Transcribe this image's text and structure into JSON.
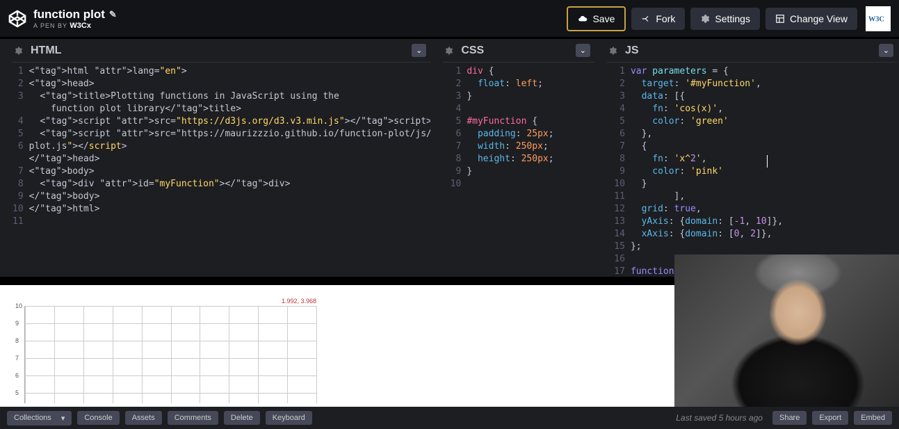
{
  "header": {
    "title": "function plot",
    "byline_prefix": "A PEN BY",
    "byline_author": "W3Cx"
  },
  "actions": {
    "save": "Save",
    "fork": "Fork",
    "settings": "Settings",
    "change_view": "Change View"
  },
  "panels": {
    "html": {
      "title": "HTML"
    },
    "css": {
      "title": "CSS"
    },
    "js": {
      "title": "JS"
    }
  },
  "code_html": [
    "<html lang=\"en\">",
    "<head>",
    "  <title>Plotting functions in JavaScript using the",
    "    function plot library</title>",
    "  <script src=\"https://d3js.org/d3.v3.min.js\"></script>",
    "  <script src=\"https://maurizzzio.github.io/function-plot/js/function-",
    "plot.js\"></script>",
    "</head>",
    "<body>",
    "  <div id=\"myFunction\"></div>",
    "</body>",
    "</html>"
  ],
  "code_css": [
    "div {",
    "  float: left;",
    "}",
    "",
    "#myFunction {",
    "  padding: 25px;",
    "  width: 250px;",
    "  height: 250px;",
    "}"
  ],
  "code_js": [
    "var parameters = {",
    "  target: '#myFunction',",
    "  data: [{",
    "    fn: 'cos(x)',",
    "    color: 'green'",
    "  },",
    "  {",
    "    fn: 'x^2',",
    "    color: 'pink'",
    "  }",
    "        ],",
    "  grid: true,",
    "  yAxis: {domain: [-1, 10]},",
    "  xAxis: {domain: [0, 2]},",
    "};",
    "",
    "function"
  ],
  "line_numbers": {
    "html": [
      "1",
      "2",
      "3",
      "",
      "4",
      "5",
      "6",
      "",
      "7",
      "8",
      "9",
      "10",
      "11"
    ],
    "css": [
      "1",
      "2",
      "3",
      "4",
      "5",
      "6",
      "7",
      "8",
      "9",
      "10"
    ],
    "js": [
      "1",
      "2",
      "3",
      "4",
      "5",
      "6",
      "7",
      "8",
      "9",
      "10",
      "11",
      "12",
      "13",
      "14",
      "15",
      "16",
      "17"
    ]
  },
  "chart_data": {
    "type": "line",
    "tooltip": "1.992, 3.968",
    "y_ticks": [
      10,
      9,
      8,
      7,
      6,
      5
    ],
    "y_range_visible": [
      5,
      10
    ],
    "grid_cols": 10,
    "x_domain": [
      0,
      2
    ],
    "y_domain": [
      -1,
      10
    ],
    "series": [
      {
        "name": "cos(x)",
        "color": "green"
      },
      {
        "name": "x^2",
        "color": "pink"
      }
    ]
  },
  "footer": {
    "collections": "Collections",
    "console": "Console",
    "assets": "Assets",
    "comments": "Comments",
    "delete": "Delete",
    "keyboard": "Keyboard",
    "saved": "Last saved 5 hours ago",
    "share": "Share",
    "export": "Export",
    "embed": "Embed"
  }
}
